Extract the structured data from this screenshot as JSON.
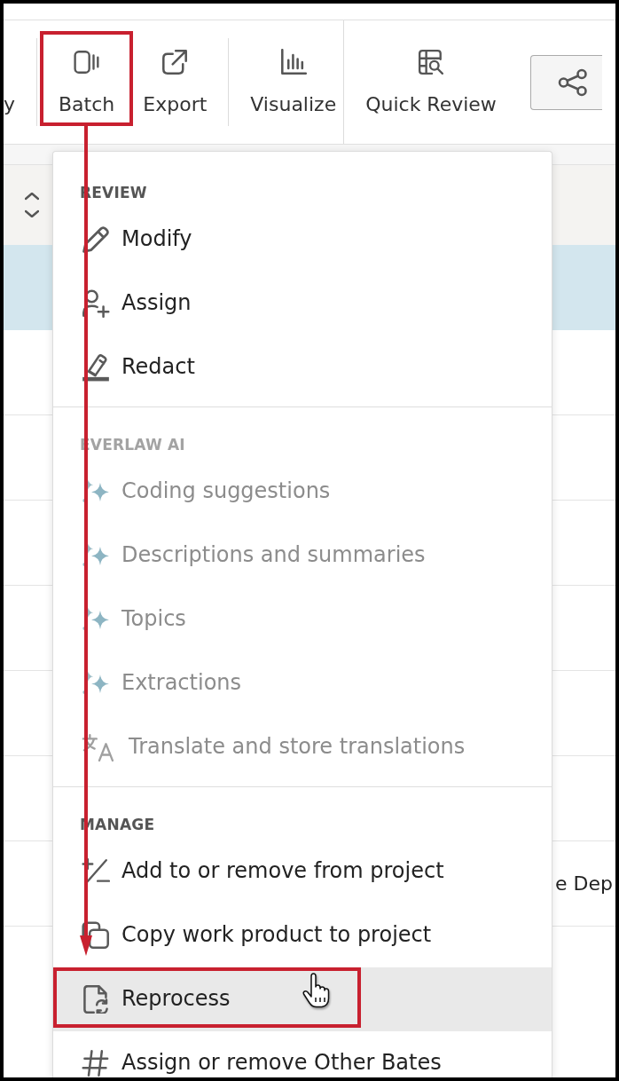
{
  "toolbar": {
    "sections": [
      {
        "groups": [
          {
            "buttons": [
              {
                "label": "y",
                "callout": false
              }
            ]
          },
          {
            "buttons": [
              {
                "label": "Batch",
                "callout": true
              },
              {
                "label": "Export",
                "callout": false
              }
            ]
          },
          {
            "buttons": [
              {
                "label": "Visualize",
                "callout": false
              }
            ]
          }
        ]
      },
      {
        "groups": [
          {
            "buttons": [
              {
                "label": "Quick Review",
                "callout": false
              }
            ]
          }
        ]
      }
    ]
  },
  "table": {
    "rows": [
      {
        "selected": true
      },
      {
        "selected": false
      },
      {
        "selected": false
      },
      {
        "selected": false
      },
      {
        "selected": false
      },
      {
        "selected": false
      },
      {
        "selected": false
      },
      {
        "selected": false,
        "text": "e Dep"
      },
      {
        "selected": false
      }
    ]
  },
  "batch_menu": {
    "sections": [
      {
        "heading": "REVIEW",
        "disabled": false,
        "items": [
          {
            "label": "Modify",
            "disabled": false,
            "hovered": false,
            "callout": false
          },
          {
            "label": "Assign",
            "disabled": false,
            "hovered": false,
            "callout": false
          },
          {
            "label": "Redact",
            "disabled": false,
            "hovered": false,
            "callout": false
          }
        ]
      },
      {
        "heading": "EVERLAW AI",
        "disabled": true,
        "items": [
          {
            "label": "Coding suggestions",
            "disabled": true,
            "hovered": false,
            "callout": false
          },
          {
            "label": "Descriptions and summaries",
            "disabled": true,
            "hovered": false,
            "callout": false
          },
          {
            "label": "Topics",
            "disabled": true,
            "hovered": false,
            "callout": false
          },
          {
            "label": "Extractions",
            "disabled": true,
            "hovered": false,
            "callout": false
          },
          {
            "label": "Translate and store translations",
            "disabled": true,
            "hovered": false,
            "callout": false
          }
        ]
      },
      {
        "heading": "MANAGE",
        "disabled": false,
        "items": [
          {
            "label": "Add to or remove from project",
            "disabled": false,
            "hovered": false,
            "callout": false
          },
          {
            "label": "Copy work product to project",
            "disabled": false,
            "hovered": false,
            "callout": false
          },
          {
            "label": "Reprocess",
            "disabled": false,
            "hovered": true,
            "callout": true
          },
          {
            "label": "Assign or remove Other Bates",
            "disabled": false,
            "hovered": false,
            "callout": false
          }
        ]
      }
    ]
  }
}
